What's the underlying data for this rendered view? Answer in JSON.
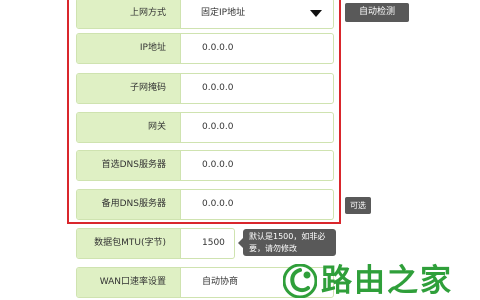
{
  "form": {
    "connection_type": {
      "label": "上网方式",
      "value": "固定IP地址"
    },
    "ip_address": {
      "label": "IP地址",
      "value": "0.0.0.0"
    },
    "subnet_mask": {
      "label": "子网掩码",
      "value": "0.0.0.0"
    },
    "gateway": {
      "label": "网关",
      "value": "0.0.0.0"
    },
    "primary_dns": {
      "label": "首选DNS服务器",
      "value": "0.0.0.0"
    },
    "secondary_dns": {
      "label": "备用DNS服务器",
      "value": "0.0.0.0",
      "tag": "可选"
    },
    "mtu": {
      "label": "数据包MTU(字节)",
      "value": "1500",
      "hint": "默认是1500，如非必要，请勿修改"
    },
    "wan_speed": {
      "label": "WAN口速率设置",
      "value": "自动协商"
    }
  },
  "auto_detect_button": "自动检测",
  "watermark": {
    "text": "路由之家"
  },
  "colors": {
    "label_bg": "#dff0c4",
    "highlight_border": "#d9262c",
    "button_bg": "#595959",
    "watermark_green": "#2f9f3a"
  }
}
